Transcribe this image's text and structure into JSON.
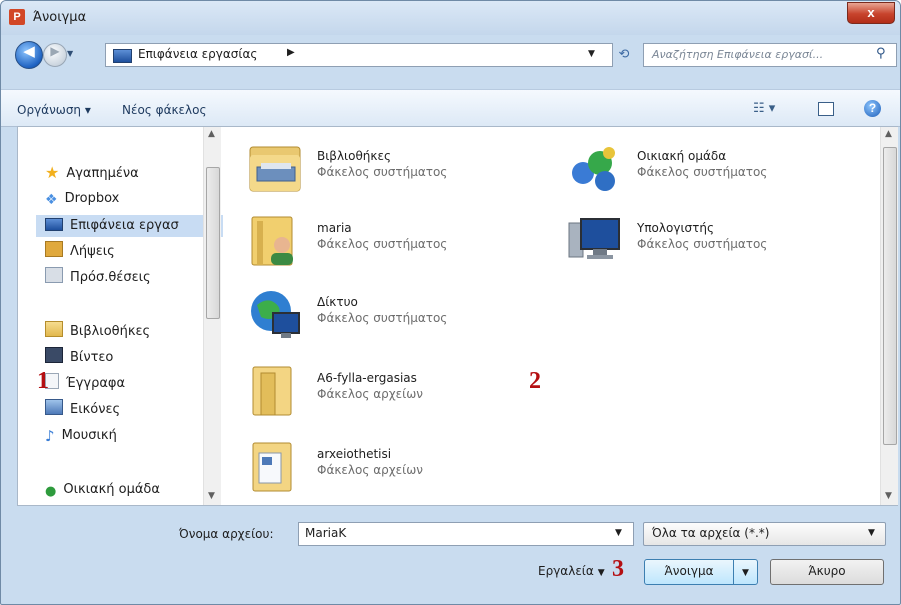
{
  "window": {
    "title": "Άνοιγμα",
    "app_icon_letter": "P",
    "close_glyph": "x"
  },
  "nav_bar": {
    "back_glyph": "◀",
    "forward_glyph": "▶",
    "address_path": "Επιφάνεια εργασίας",
    "address_separator": "▶",
    "refresh_glyph": "⟲",
    "search_placeholder": "Αναζήτηση Επιφάνεια εργασί...",
    "search_glyph": "⚲"
  },
  "toolbar": {
    "organize_label": "Οργάνωση ▾",
    "new_folder_label": "Νέος φάκελος",
    "views_glyph": "☷ ▾",
    "help_glyph": "?"
  },
  "sidebar": {
    "items": [
      {
        "label": "Αγαπημένα",
        "icon": "star-icon",
        "color": "#f2b01e"
      },
      {
        "label": "Dropbox",
        "icon": "dropbox-icon",
        "color": "#4a90e2"
      },
      {
        "label": "Επιφάνεια εργασ",
        "icon": "desktop-icon",
        "color": "#2a63c6"
      },
      {
        "label": "Λήψεις",
        "icon": "downloads-icon",
        "color": "#e0a93d"
      },
      {
        "label": "Πρόσ.θέσεις",
        "icon": "recent-places-icon",
        "color": "#8a9bb0"
      },
      {
        "label": "Βιβλιοθήκες",
        "icon": "libraries-icon",
        "color": "#e9c56a"
      },
      {
        "label": "Βίντεο",
        "icon": "video-icon",
        "color": "#3a4a66"
      },
      {
        "label": "Έγγραφα",
        "icon": "documents-icon",
        "color": "#b9c6d6"
      },
      {
        "label": "Εικόνες",
        "icon": "pictures-icon",
        "color": "#4d79b8"
      },
      {
        "label": "Μουσική",
        "icon": "music-icon",
        "color": "#3b7ed6"
      },
      {
        "label": "Οικιακή ομάδα",
        "icon": "homegroup-icon",
        "color": "#2e9b3d"
      }
    ]
  },
  "files": [
    {
      "name": "Βιβλιοθήκες",
      "type": "Φάκελος συστήματος",
      "icon": "libraries-folder-icon"
    },
    {
      "name": "Οικιακή ομάδα",
      "type": "Φάκελος συστήματος",
      "icon": "homegroup-icon"
    },
    {
      "name": "maria",
      "type": "Φάκελος συστήματος",
      "icon": "user-folder-icon"
    },
    {
      "name": "Υπολογιστής",
      "type": "Φάκελος συστήματος",
      "icon": "computer-icon"
    },
    {
      "name": "Δίκτυο",
      "type": "Φάκελος συστήματος",
      "icon": "network-icon"
    },
    {
      "name": "A6-fylla-ergasias",
      "type": "Φάκελος αρχείων",
      "icon": "folder-icon"
    },
    {
      "name": "arxeiothetisi",
      "type": "Φάκελος αρχείων",
      "icon": "folder-icon"
    }
  ],
  "annotations": {
    "one": "1",
    "two": "2",
    "three": "3"
  },
  "bottom": {
    "file_name_label": "Όνομα αρχείου:",
    "file_name_value": "MariaK",
    "file_type_value": "Όλα τα αρχεία (*.*)",
    "tools_label": "Εργαλεία",
    "open_label": "Άνοιγμα",
    "cancel_label": "Άκυρο"
  }
}
